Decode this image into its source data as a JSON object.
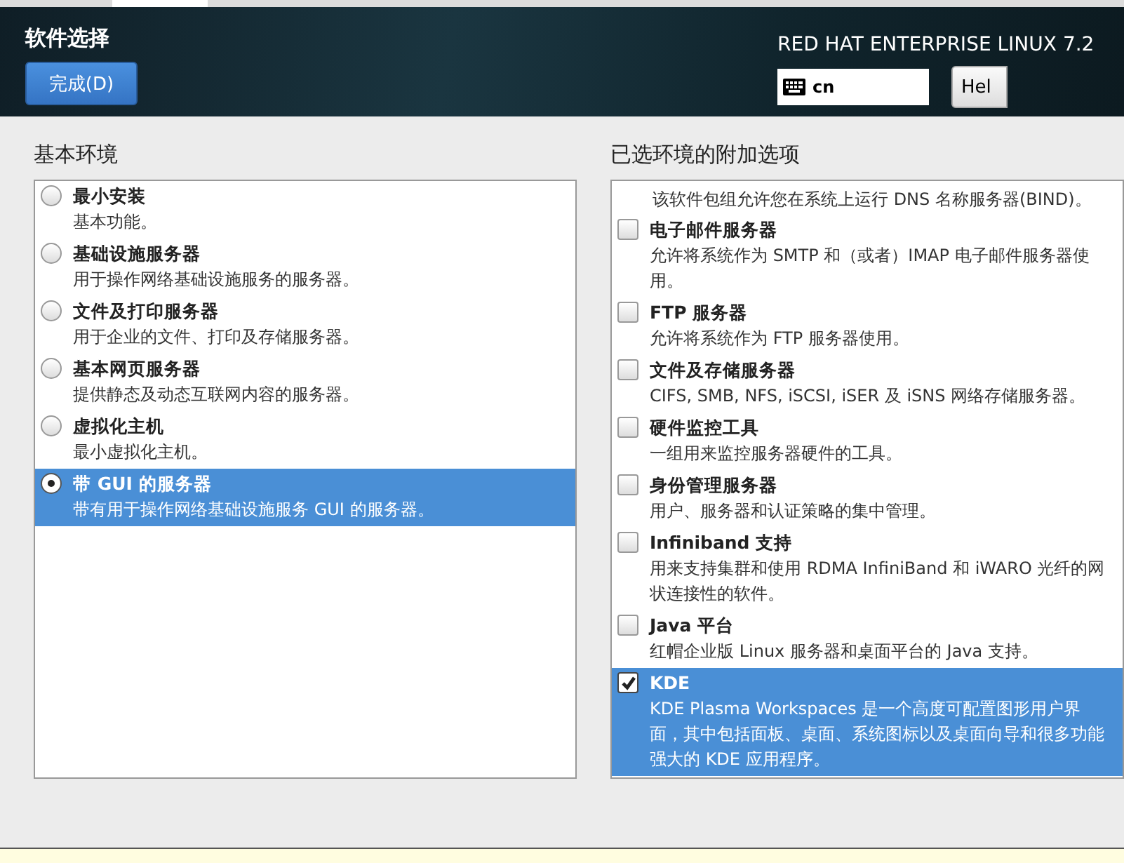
{
  "header": {
    "title": "软件选择",
    "done_button": "完成(D)",
    "product": "RED HAT ENTERPRISE LINUX 7.2",
    "keyboard_layout": "cn",
    "help_button": "Hel"
  },
  "base_environment": {
    "heading": "基本环境",
    "items": [
      {
        "name": "最小安装",
        "description": "基本功能。",
        "selected": false
      },
      {
        "name": "基础设施服务器",
        "description": "用于操作网络基础设施服务的服务器。",
        "selected": false
      },
      {
        "name": "文件及打印服务器",
        "description": "用于企业的文件、打印及存储服务器。",
        "selected": false
      },
      {
        "name": "基本网页服务器",
        "description": "提供静态及动态互联网内容的服务器。",
        "selected": false
      },
      {
        "name": "虚拟化主机",
        "description": "最小虚拟化主机。",
        "selected": false
      },
      {
        "name": "带 GUI 的服务器",
        "description": "带有用于操作网络基础设施服务 GUI 的服务器。",
        "selected": true
      }
    ]
  },
  "addons": {
    "heading": "已选环境的附加选项",
    "partial_description": "该软件包组允许您在系统上运行 DNS 名称服务器(BIND)。",
    "items": [
      {
        "name": "电子邮件服务器",
        "description": "允许将系统作为 SMTP 和（或者）IMAP 电子邮件服务器使用。",
        "checked": false
      },
      {
        "name": "FTP 服务器",
        "description": "允许将系统作为 FTP 服务器使用。",
        "checked": false
      },
      {
        "name": "文件及存储服务器",
        "description": "CIFS, SMB, NFS, iSCSI, iSER 及 iSNS 网络存储服务器。",
        "checked": false
      },
      {
        "name": "硬件监控工具",
        "description": "一组用来监控服务器硬件的工具。",
        "checked": false
      },
      {
        "name": "身份管理服务器",
        "description": "用户、服务器和认证策略的集中管理。",
        "checked": false
      },
      {
        "name": "Infiniband 支持",
        "description": "用来支持集群和使用 RDMA InfiniBand 和 iWARO 光纤的网状连接性的软件。",
        "checked": false
      },
      {
        "name": "Java 平台",
        "description": "红帽企业版 Linux 服务器和桌面平台的 Java 支持。",
        "checked": false
      },
      {
        "name": "KDE",
        "description": " KDE Plasma Workspaces 是一个高度可配置图形用户界面，其中包括面板、桌面、系统图标以及桌面向导和很多功能强大的 KDE 应用程序。",
        "checked": true
      }
    ]
  }
}
